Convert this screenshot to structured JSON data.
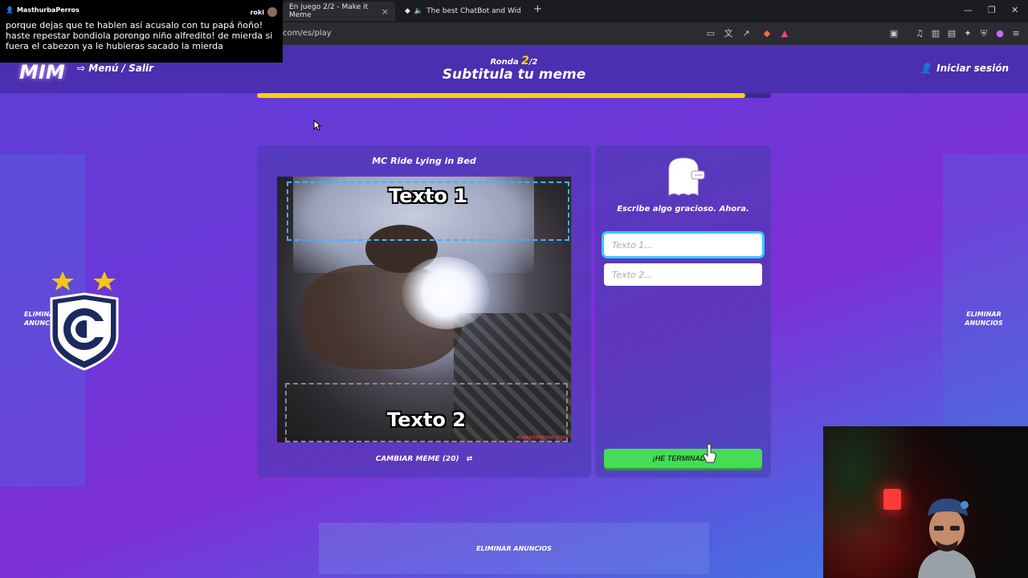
{
  "browser": {
    "tabs": [
      {
        "title": "En juego 2/2 - Make it Meme",
        "active": true
      },
      {
        "title": "The best ChatBot and Widgets fo",
        "active": false
      }
    ],
    "url": "com/es/play"
  },
  "chat": {
    "username": "MasthurbaPerros",
    "right_user": "roki",
    "message": "porque dejas que te hablen así acusalo con tu papá ñoño! haste repestar bondiola porongo niño alfredito! de mierda si fuera el cabezon ya le hubieras sacado la mierda"
  },
  "header": {
    "logo": "MIM",
    "menu_label": "Menú / Salir",
    "round_label": "Ronda",
    "round_current": "2",
    "round_total": "/2",
    "title": "Subtitula tu meme",
    "login_label": "Iniciar sesión",
    "progress": 1.0
  },
  "meme": {
    "title": "MC Ride Lying in Bed",
    "text1": "Texto 1",
    "text2": "Texto 2",
    "watermark": "makeitmeme.com",
    "change_label": "CAMBIAR MEME (20)"
  },
  "input_panel": {
    "prompt": "Escribe algo gracioso. Ahora.",
    "field1_placeholder": "Texto 1...",
    "field2_placeholder": "Texto 2...",
    "done_label": "¡HE TERMINADO!"
  },
  "ads": {
    "left_label": "ELIMINAR ANUNCIOS",
    "right_label": "ELIMINAR ANUNCIOS",
    "bottom_label": "ELIMINAR ANUNCIOS"
  },
  "colors": {
    "accent_yellow": "#f5d400",
    "done_green": "#44dd55",
    "focus_blue": "#36c8ff"
  }
}
